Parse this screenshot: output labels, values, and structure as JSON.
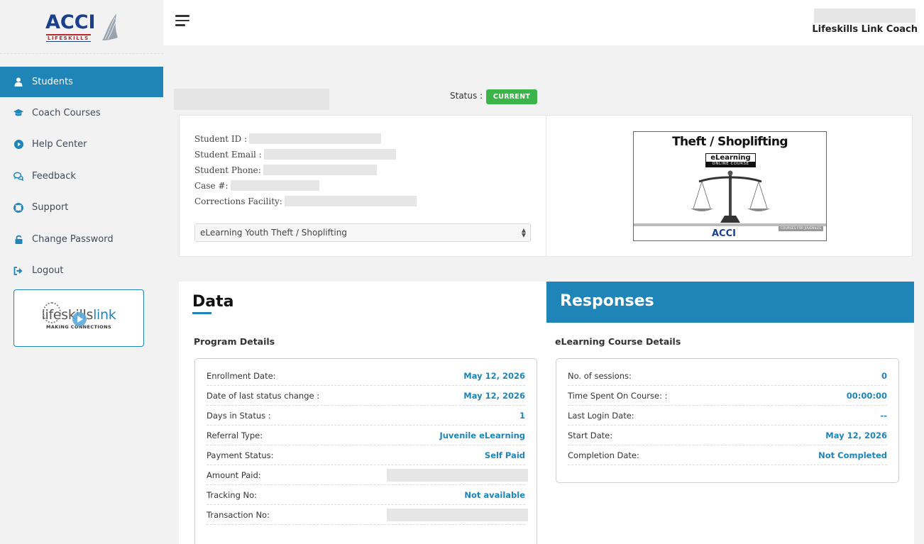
{
  "sidebar": {
    "logo": {
      "brand": "ACCI",
      "sub": "LIFESKILLS"
    },
    "items": [
      {
        "label": "Students",
        "icon": "user-icon",
        "active": true
      },
      {
        "label": "Coach Courses",
        "icon": "graduation-cap-icon"
      },
      {
        "label": "Help Center",
        "icon": "play-circle-icon"
      },
      {
        "label": "Feedback",
        "icon": "chat-bubbles-icon"
      },
      {
        "label": "Support",
        "icon": "lifebuoy-icon"
      },
      {
        "label": "Change Password",
        "icon": "lock-icon"
      },
      {
        "label": "Logout",
        "icon": "logout-icon"
      }
    ],
    "promo": {
      "title_a": "lifeskills",
      "title_b": "link",
      "subtitle": "MAKING CONNECTIONS"
    }
  },
  "topbar": {
    "role": "Lifeskills Link Coach"
  },
  "student": {
    "status_label": "Status :",
    "status_value": "CURRENT",
    "fields": {
      "student_id": "Student ID :",
      "student_email": "Student Email :",
      "student_phone": "Student Phone:",
      "case_no": "Case #:",
      "facility": "Corrections Facility:"
    },
    "course_select": "eLearning Youth Theft / Shoplifting"
  },
  "course_image": {
    "title": "Theft / Shoplifting",
    "badge_top": "eLearning",
    "badge_bottom": "ONLINE COURSE",
    "footer_logo": "ACCI",
    "footer_tag": "COURSES FOR JUVENILES"
  },
  "colors": {
    "accent": "#1f84b7",
    "status_green": "#3bb54a"
  },
  "data_panel": {
    "title": "Data",
    "section": "Program Details",
    "rows": [
      {
        "label": "Enrollment Date:",
        "value": "May 12, 2026"
      },
      {
        "label": "Date of last status change :",
        "value": "May 12, 2026"
      },
      {
        "label": "Days in Status :",
        "value": "1"
      },
      {
        "label": "Referral Type:",
        "value": "Juvenile eLearning"
      },
      {
        "label": "Payment Status:",
        "value": "Self Paid"
      },
      {
        "label": "Amount Paid:"
      },
      {
        "label": "Tracking No:",
        "value": "Not available"
      },
      {
        "label": "Transaction No:"
      }
    ]
  },
  "responses_panel": {
    "title": "Responses",
    "section": "eLearning Course Details",
    "rows": [
      {
        "label": "No. of sessions:",
        "value": "0"
      },
      {
        "label": "Time Spent On Course: :",
        "value": "00:00:00"
      },
      {
        "label": "Last Login Date:",
        "value": "--"
      },
      {
        "label": "Start Date:",
        "value": "May 12, 2026"
      },
      {
        "label": "Completion Date:",
        "value": "Not Completed"
      }
    ]
  }
}
